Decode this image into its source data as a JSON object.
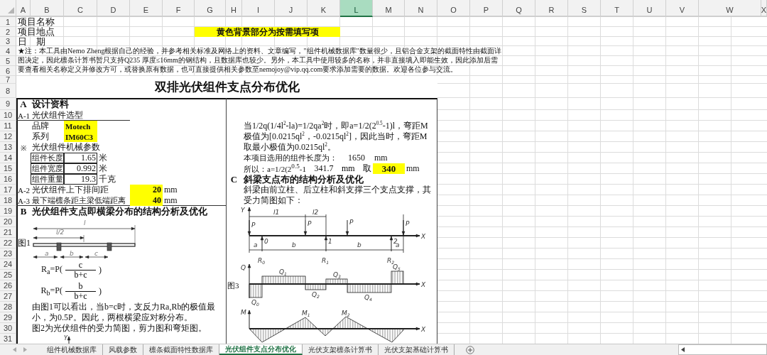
{
  "columns": [
    {
      "label": "A",
      "selected": false
    },
    {
      "label": "B",
      "selected": false
    },
    {
      "label": "C",
      "selected": false
    },
    {
      "label": "D",
      "selected": false
    },
    {
      "label": "E",
      "selected": false
    },
    {
      "label": "F",
      "selected": false
    },
    {
      "label": "G",
      "selected": false
    },
    {
      "label": "H",
      "selected": false
    },
    {
      "label": "I",
      "selected": false
    },
    {
      "label": "J",
      "selected": false
    },
    {
      "label": "K",
      "selected": false
    },
    {
      "label": "L",
      "selected": true
    },
    {
      "label": "M",
      "selected": false
    },
    {
      "label": "N",
      "selected": false
    },
    {
      "label": "O",
      "selected": false
    },
    {
      "label": "P",
      "selected": false
    },
    {
      "label": "Q",
      "selected": false
    },
    {
      "label": "R",
      "selected": false
    },
    {
      "label": "S",
      "selected": false
    },
    {
      "label": "T",
      "selected": false
    },
    {
      "label": "U",
      "selected": false
    },
    {
      "label": "V",
      "selected": false
    },
    {
      "label": "W",
      "selected": false
    },
    {
      "label": "X",
      "selected": false
    }
  ],
  "rows": [
    "1",
    "2",
    "3",
    "4",
    "5",
    "6",
    "7",
    "8",
    "9",
    "10",
    "11",
    "12",
    "13",
    "14",
    "15",
    "16",
    "17",
    "18",
    "19",
    "20",
    "21",
    "22",
    "23",
    "24",
    "25",
    "26",
    "27",
    "28",
    "29",
    "30",
    "31"
  ],
  "project_fields": [
    "项目名称",
    "项目地点",
    "日　期"
  ],
  "banner": "黄色背景部分为按需填写项",
  "note": "★注：本工具由Nemo Zheng根据自己的经验，并参考相关标准及网络上的资料、文章编写，\"组件机械数据库\"数量很少，且铝合金支架的截面特性由截面详图决定，因此檩条计算书暂只支持Q235 厚度≤16mm的钢结构，且数据库也较少。另外，本工具中使用较多的名称，并非直接填入即能生效，因此添加后需要查看相关名称定义并修改方可，或替换原有数据，也可直接提供相关参数至nemojoy@vip.qq.com要求添加需要的数据。欢迎各位参与交流。",
  "title": "双排光伏组件支点分布优化",
  "section_a": {
    "marker": "A",
    "heading": "设计资料"
  },
  "module_selection": {
    "code": "A-1",
    "label": "光伏组件选型",
    "items": [
      {
        "label": "品牌",
        "value": "Motech"
      },
      {
        "label": "系列",
        "value": "IM60C3"
      }
    ]
  },
  "mechanical": {
    "marker": "※",
    "label": "光伏组件机械参数",
    "rows": [
      {
        "label": "组件长度",
        "value": "1.65",
        "unit": "米"
      },
      {
        "label": "组件宽度",
        "value": "0.992",
        "unit": "米"
      },
      {
        "label": "组件重量",
        "value": "19.3",
        "unit": "千克"
      }
    ]
  },
  "spacing": [
    {
      "code": "A-2",
      "label": "光伏组件上下排间距",
      "value": "20",
      "unit": "mm"
    },
    {
      "code": "A-3",
      "label": "最下端檩条距主梁低端距离",
      "value": "40",
      "unit": "mm"
    }
  ],
  "section_b": {
    "marker": "B",
    "heading": "光伏组件支点即横梁分布的结构分析及优化"
  },
  "figure1": {
    "caption": "图1",
    "labels": [
      "l",
      "l/2",
      "a",
      "b",
      "c"
    ]
  },
  "formulas": [
    {
      "lhs": "R$_{a}$=P(",
      "numerator": "c",
      "denominator": "b+c",
      "close": ")"
    },
    {
      "lhs": "R$_{b}$=P(",
      "numerator": "b",
      "denominator": "b+c",
      "close": ")"
    }
  ],
  "conclusion": [
    "由图1可以看出，当b=c时，支反力Ra,Rb的极值最小，为0.5P。因此，两根横梁应对称分布。",
    "图2为光伏组件的受力简图，剪力图和弯矩图。"
  ],
  "figure2": {
    "axis_label": "Y"
  },
  "analysis": {
    "text": "当1/2q(1/4l$^{2}$-la)=1/2qa$^{2}$时，即a=1/2(2$^{0.5}$-1)l，弯距M 极值为[0.0215ql$^{2}$，-0.0215ql$^{2}$]，因此当时，弯距M 取最小极值为0.0215ql$^{2}$。",
    "length_label": "本项目选用的组件长度为：",
    "length_value": "1650",
    "length_unit": "mm",
    "result_label": "所以：a=1/2(2$^{0.5}$-1",
    "result_value": "341.7",
    "result_unit": "mm",
    "take_label": "取",
    "chosen_value": "340",
    "chosen_unit": "mm"
  },
  "section_c": {
    "marker": "C",
    "heading": "斜梁支点布的结构分析及优化",
    "description": "斜梁由前立柱、后立柱和斜支撑三个支点支撑，其受力简图如下："
  },
  "figure3": {
    "caption": "图3",
    "labels": [
      {
        "text": "Y"
      },
      {
        "text": "l1"
      },
      {
        "text": "l2"
      },
      {
        "text": "P"
      },
      {
        "text": "P"
      },
      {
        "text": "P"
      },
      {
        "text": "P"
      },
      {
        "text": "0"
      },
      {
        "text": "1"
      },
      {
        "text": "2"
      },
      {
        "text": "X"
      },
      {
        "text": "a"
      },
      {
        "text": "b"
      },
      {
        "text": "b"
      },
      {
        "text": "a"
      },
      {
        "text": "R",
        "sub": "0"
      },
      {
        "text": "R",
        "sub": "1"
      },
      {
        "text": "R",
        "sub": "2"
      },
      {
        "text": "Q"
      },
      {
        "text": "Q",
        "sub": "1"
      },
      {
        "text": "Q",
        "sub": "3"
      },
      {
        "text": "Q",
        "sub": "5"
      },
      {
        "text": "X"
      },
      {
        "text": "Q",
        "sub": "0"
      },
      {
        "text": "Q",
        "sub": "2"
      },
      {
        "text": "Q",
        "sub": "4"
      },
      {
        "text": "M"
      },
      {
        "text": "M",
        "sub": "1"
      },
      {
        "text": "M",
        "sub": "2"
      },
      {
        "text": "X"
      }
    ]
  },
  "tabs": [
    {
      "label": "组件机械数据库",
      "selected": false
    },
    {
      "label": "风载参数",
      "selected": false
    },
    {
      "label": "檩条截面特性数据库",
      "selected": false
    },
    {
      "label": "光伏组件支点分布优化",
      "selected": true
    },
    {
      "label": "光伏支架檩条计算书",
      "selected": false
    },
    {
      "label": "光伏支架基础计算书",
      "selected": false
    }
  ]
}
